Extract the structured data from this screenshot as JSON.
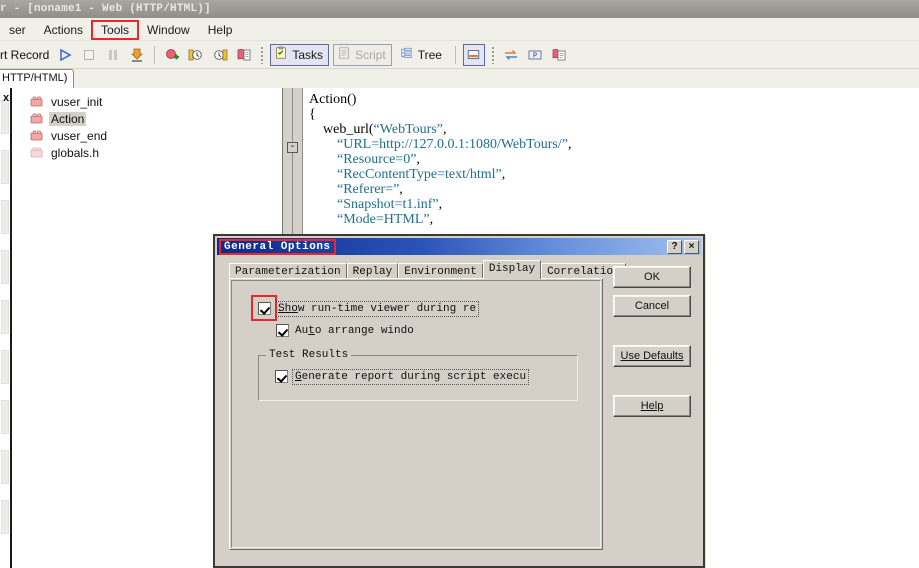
{
  "window": {
    "title": "r - [noname1 - Web (HTTP/HTML)]"
  },
  "menubar": {
    "items": [
      {
        "label": "ser",
        "name": "menu-vuser"
      },
      {
        "label": "Actions",
        "name": "menu-actions"
      },
      {
        "label": "Tools",
        "name": "menu-tools",
        "highlighted": true
      },
      {
        "label": "Window",
        "name": "menu-window"
      },
      {
        "label": "Help",
        "name": "menu-help"
      }
    ]
  },
  "toolbar": {
    "record_label": "rt Record",
    "tasks_label": "Tasks",
    "script_label": "Script",
    "tree_label": "Tree",
    "icons": {
      "run": "play-icon",
      "stop": "stop-icon",
      "pause": "pause-icon",
      "download": "download-icon",
      "add_snapshot": "add-snapshot-icon",
      "step_prev": "step-back-icon",
      "step_next": "step-forward-icon",
      "report": "report-icon",
      "tasks": "tasks-checklist-icon",
      "script": "script-document-icon",
      "tree": "tree-outline-icon",
      "split": "split-view-icon",
      "swap": "swap-arrows-icon",
      "param": "parameter-icon",
      "copy": "copy-icon"
    }
  },
  "doctab": {
    "label": "HTTP/HTML)"
  },
  "tree": {
    "close_label": "x",
    "items": [
      {
        "label": "vuser_init",
        "icon": "brick-icon",
        "selected": false
      },
      {
        "label": "Action",
        "icon": "brick-icon",
        "selected": true
      },
      {
        "label": "vuser_end",
        "icon": "brick-icon",
        "selected": false
      },
      {
        "label": "globals.h",
        "icon": "header-file-icon",
        "selected": false
      }
    ]
  },
  "editor": {
    "fold_marker": "-",
    "lines": [
      {
        "indent": 0,
        "parts": [
          {
            "t": "Action()",
            "c": "plain"
          }
        ]
      },
      {
        "indent": 0,
        "parts": [
          {
            "t": "{",
            "c": "plain"
          }
        ]
      },
      {
        "indent": 0,
        "parts": [
          {
            "t": "",
            "c": "plain"
          }
        ]
      },
      {
        "indent": 4,
        "parts": [
          {
            "t": "web_url(",
            "c": "plain"
          },
          {
            "t": "“WebTours”",
            "c": "str"
          },
          {
            "t": ",",
            "c": "plain"
          }
        ]
      },
      {
        "indent": 8,
        "parts": [
          {
            "t": "“URL=http://127.0.0.1:1080/WebTours/”",
            "c": "str"
          },
          {
            "t": ",",
            "c": "plain"
          }
        ]
      },
      {
        "indent": 8,
        "parts": [
          {
            "t": "“Resource=0”",
            "c": "str"
          },
          {
            "t": ",",
            "c": "plain"
          }
        ]
      },
      {
        "indent": 8,
        "parts": [
          {
            "t": "“RecContentType=text/html”",
            "c": "str"
          },
          {
            "t": ",",
            "c": "plain"
          }
        ]
      },
      {
        "indent": 8,
        "parts": [
          {
            "t": "“Referer=”",
            "c": "str"
          },
          {
            "t": ",",
            "c": "plain"
          }
        ]
      },
      {
        "indent": 8,
        "parts": [
          {
            "t": "“Snapshot=t1.inf”",
            "c": "str"
          },
          {
            "t": ",",
            "c": "plain"
          }
        ]
      },
      {
        "indent": 8,
        "parts": [
          {
            "t": "“Mode=HTML”",
            "c": "str"
          },
          {
            "t": ",",
            "c": "plain"
          }
        ]
      }
    ]
  },
  "dialog": {
    "title": "General Options",
    "help_btn": "?",
    "close_btn": "×",
    "tabs": [
      {
        "label": "Parameterization",
        "active": false
      },
      {
        "label": "Replay",
        "active": false
      },
      {
        "label": "Environment",
        "active": false
      },
      {
        "label": "Display",
        "active": true
      },
      {
        "label": "Correlation",
        "active": false
      }
    ],
    "display": {
      "show_runtime_viewer": {
        "label_pre": "Sh",
        "label_acc": "o",
        "label_post": "w run-time viewer during re",
        "checked": true,
        "highlighted": true
      },
      "auto_arrange": {
        "label_pre": "Au",
        "label_acc": "t",
        "label_post": "o arrange windo",
        "checked": true
      },
      "test_results_group": "Test Results",
      "generate_report": {
        "label_pre": "",
        "label_acc": "G",
        "label_post": "enerate report during script execu",
        "checked": true
      }
    },
    "buttons": [
      {
        "label": "OK",
        "name": "ok-button"
      },
      {
        "label": "Cancel",
        "name": "cancel-button"
      },
      {
        "label": "Use Defaults",
        "name": "use-defaults-button",
        "acc": "U"
      },
      {
        "label": "Help",
        "name": "help-button",
        "acc": "H"
      }
    ]
  },
  "colors": {
    "dialog_face": "#d4d0c8",
    "title_gradient_start": "#0a2a8c",
    "highlight_red": "#e8282a",
    "code_string": "#1f6f8f",
    "toolbar_face": "#f0f0e8"
  }
}
